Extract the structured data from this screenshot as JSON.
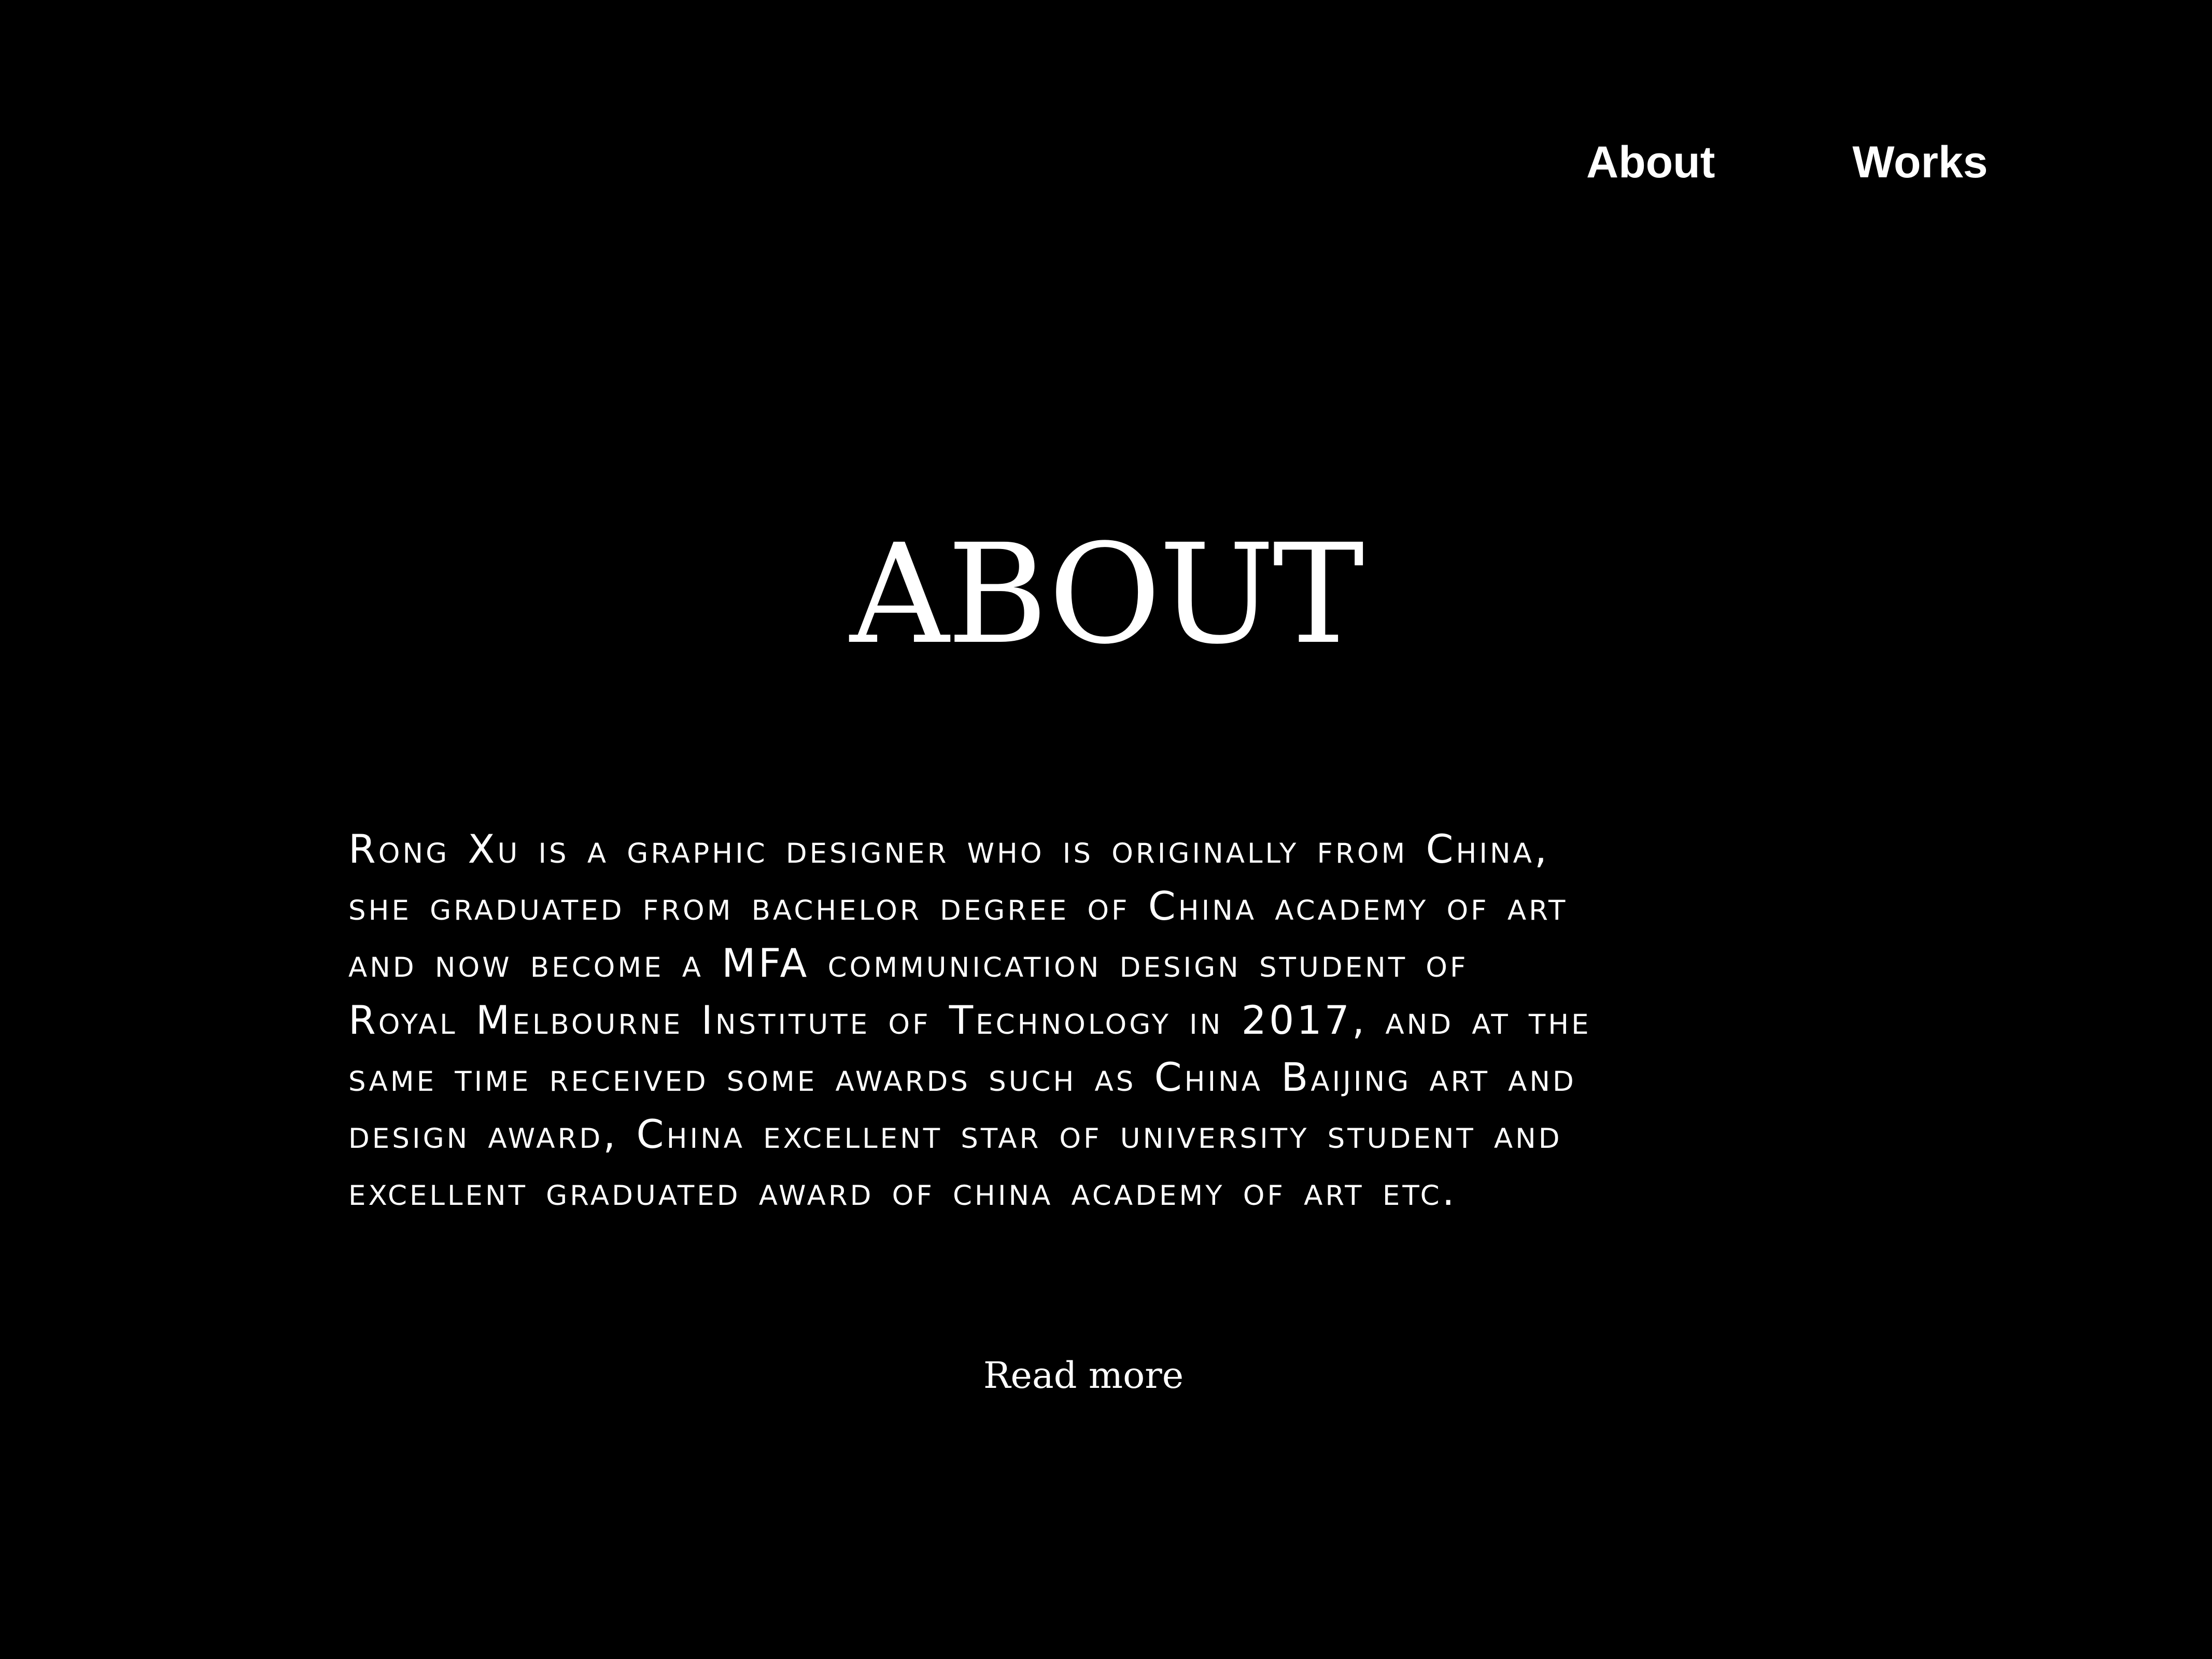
{
  "nav": {
    "items": [
      {
        "label": "About"
      },
      {
        "label": "Works"
      }
    ]
  },
  "main": {
    "title": "ABOUT",
    "bio_lines": [
      "Rong Xu is a graphic designer who is originally from China,",
      "she graduated from bachelor degree of China academy of art",
      "and now become a MFA communication design student of",
      "Royal Melbourne Institute of Technology in 2017, and at the",
      "same time received some awards such as China Baijing art and",
      "design award, China excellent star of university student and",
      "excellent graduated award of china academy of art etc."
    ],
    "read_more": "Read more"
  },
  "colors": {
    "background": "#000000",
    "text": "#ffffff"
  }
}
